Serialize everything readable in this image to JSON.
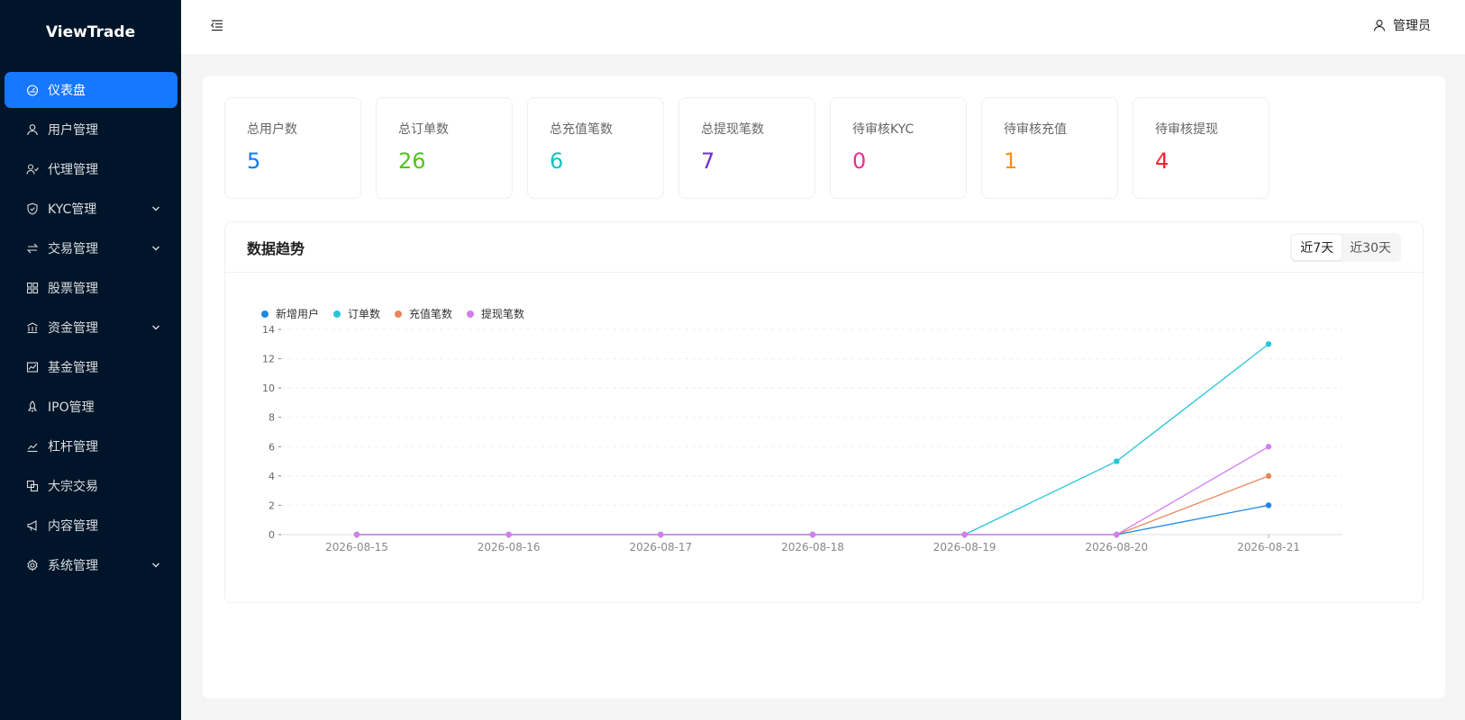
{
  "brand": "ViewTrade",
  "sidebar": {
    "items": [
      {
        "label": "仪表盘",
        "icon": "dashboard-icon",
        "active": true,
        "caret": false
      },
      {
        "label": "用户管理",
        "icon": "user-icon",
        "active": false,
        "caret": false
      },
      {
        "label": "代理管理",
        "icon": "agent-icon",
        "active": false,
        "caret": false
      },
      {
        "label": "KYC管理",
        "icon": "shield-icon",
        "active": false,
        "caret": true
      },
      {
        "label": "交易管理",
        "icon": "swap-icon",
        "active": false,
        "caret": true
      },
      {
        "label": "股票管理",
        "icon": "grid-icon",
        "active": false,
        "caret": false
      },
      {
        "label": "资金管理",
        "icon": "bank-icon",
        "active": false,
        "caret": true
      },
      {
        "label": "基金管理",
        "icon": "fund-chart-icon",
        "active": false,
        "caret": false
      },
      {
        "label": "IPO管理",
        "icon": "rocket-icon",
        "active": false,
        "caret": false
      },
      {
        "label": "杠杆管理",
        "icon": "line-chart-icon",
        "active": false,
        "caret": false
      },
      {
        "label": "大宗交易",
        "icon": "block-icon",
        "active": false,
        "caret": false
      },
      {
        "label": "内容管理",
        "icon": "megaphone-icon",
        "active": false,
        "caret": false
      },
      {
        "label": "系统管理",
        "icon": "gear-icon",
        "active": false,
        "caret": true
      }
    ]
  },
  "header": {
    "user": "管理员"
  },
  "stats": [
    {
      "label": "总用户数",
      "value": "5",
      "color": "#1677ff"
    },
    {
      "label": "总订单数",
      "value": "26",
      "color": "#52c41a"
    },
    {
      "label": "总充值笔数",
      "value": "6",
      "color": "#13c2c2"
    },
    {
      "label": "总提现笔数",
      "value": "7",
      "color": "#722ed1"
    },
    {
      "label": "待审核KYC",
      "value": "0",
      "color": "#eb2f96"
    },
    {
      "label": "待审核充值",
      "value": "1",
      "color": "#fa8c16"
    },
    {
      "label": "待审核提现",
      "value": "4",
      "color": "#f5222d"
    }
  ],
  "trend": {
    "title": "数据趋势",
    "ranges": [
      "近7天",
      "近30天"
    ],
    "active_range": 0
  },
  "chart_data": {
    "type": "line",
    "x": [
      "2026-08-15",
      "2026-08-16",
      "2026-08-17",
      "2026-08-18",
      "2026-08-19",
      "2026-08-20",
      "2026-08-21"
    ],
    "ylim": [
      0,
      14
    ],
    "yticks": [
      0,
      2,
      4,
      6,
      8,
      10,
      12,
      14
    ],
    "grid": true,
    "legend": "top-left",
    "series": [
      {
        "name": "新增用户",
        "color": "#1e88e5",
        "values": [
          0,
          0,
          0,
          0,
          0,
          0,
          2
        ]
      },
      {
        "name": "订单数",
        "color": "#26c6da",
        "values": [
          0,
          0,
          0,
          0,
          0,
          5,
          13
        ]
      },
      {
        "name": "充值笔数",
        "color": "#e8875a",
        "values": [
          0,
          0,
          0,
          0,
          0,
          0,
          4
        ]
      },
      {
        "name": "提现笔数",
        "color": "#d27ef0",
        "values": [
          0,
          0,
          0,
          0,
          0,
          0,
          6
        ]
      }
    ]
  }
}
